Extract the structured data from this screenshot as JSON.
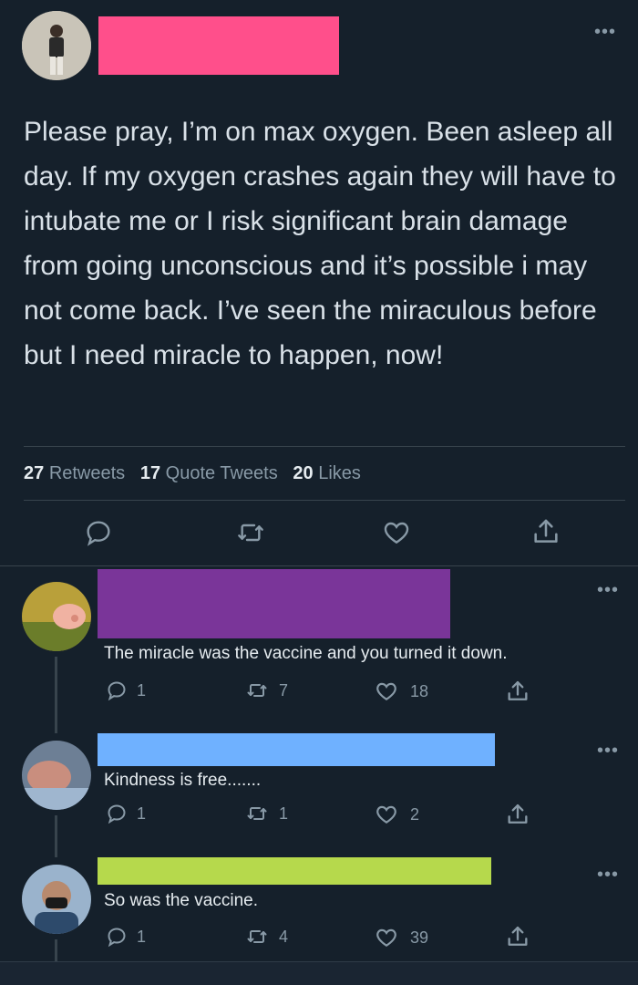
{
  "colors": {
    "background": "#15202b",
    "redacted_main": "#ff4f8b",
    "redacted_reply1": "#7a3599",
    "redacted_reply2": "#6fb1ff",
    "redacted_reply3": "#b6d94c"
  },
  "main_tweet": {
    "text": "Please pray, I’m on max oxygen. Been asleep all day. If my oxygen crashes again they will have to intubate me or I risk significant brain damage from going unconscious and it’s possible i may not come back. I’ve seen the miraculous before but I need miracle to happen, now!",
    "more": "•••",
    "stats": {
      "retweets_count": "27",
      "retweets_label": "Retweets",
      "quotes_count": "17",
      "quotes_label": "Quote Tweets",
      "likes_count": "20",
      "likes_label": "Likes"
    }
  },
  "replies": [
    {
      "text": "The miracle was the vaccine and you turned it down.",
      "more": "•••",
      "reply_count": "1",
      "retweet_count": "7",
      "like_count": "18"
    },
    {
      "text": "Kindness is free.......",
      "more": "•••",
      "reply_count": "1",
      "retweet_count": "1",
      "like_count": "2"
    },
    {
      "text": "So was the vaccine.",
      "more": "•••",
      "reply_count": "1",
      "retweet_count": "4",
      "like_count": "39"
    }
  ],
  "icons": [
    "reply-icon",
    "retweet-icon",
    "like-icon",
    "share-icon",
    "more-icon"
  ]
}
